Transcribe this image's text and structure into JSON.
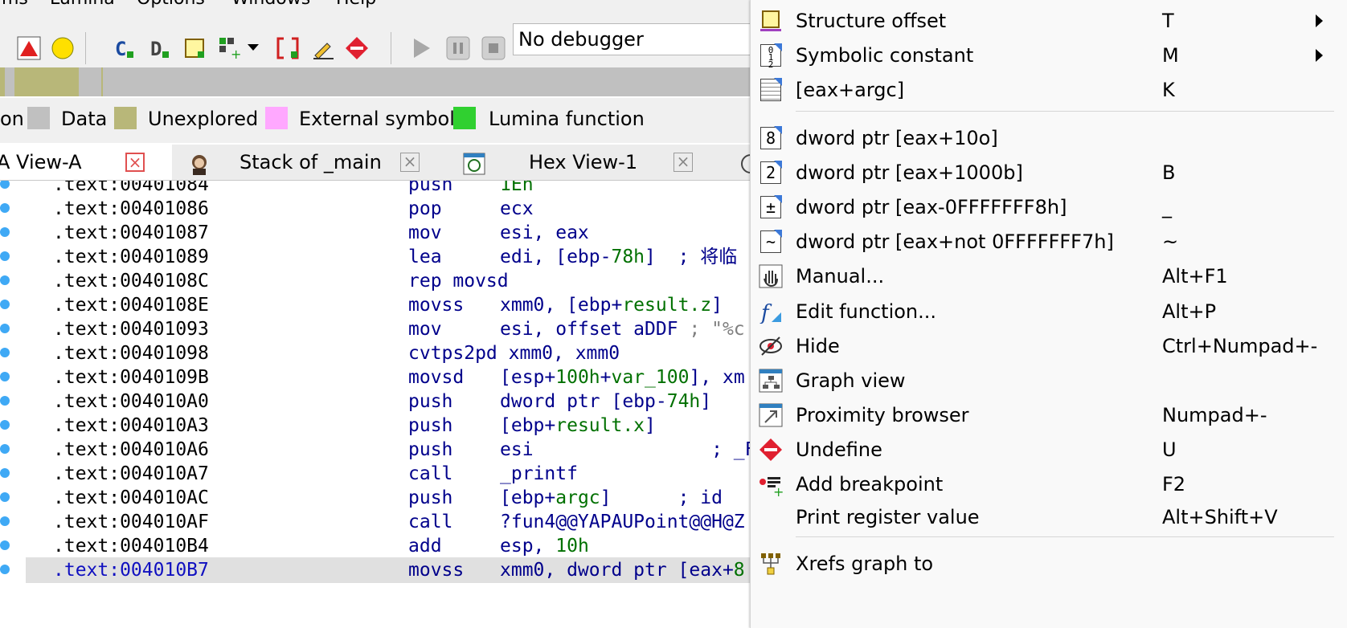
{
  "menubar": [
    "ms",
    "Lumina",
    "Options",
    "Windows",
    "Help"
  ],
  "toolbar": {
    "debugger_select": "No debugger",
    "icons": [
      "red-triangle-icon",
      "yellow-circle-icon",
      "code-icon",
      "data-icon",
      "struct-icon",
      "add-icon",
      "dropdown-icon",
      "bracket-icon",
      "edit-icon",
      "undefine-icon",
      "play-icon",
      "pause-icon",
      "stop-icon"
    ]
  },
  "legend": [
    {
      "label": "on",
      "color": null
    },
    {
      "label": "Data",
      "color": "#c0c0c0"
    },
    {
      "label": "Unexplored",
      "color": "#b8b779"
    },
    {
      "label": "External symbol",
      "color": "#ffa8ff"
    },
    {
      "label": "Lumina function",
      "color": "#30d030"
    }
  ],
  "tabs": [
    {
      "label": "A View-A"
    },
    {
      "label": "Stack of _main"
    },
    {
      "label": "Hex View-1"
    }
  ],
  "disasm": [
    {
      "addr": ".text:00401084",
      "mn": "push",
      "op": [
        [
          "1Eh",
          "g"
        ]
      ]
    },
    {
      "addr": ".text:00401086",
      "mn": "pop",
      "op": [
        [
          "ecx",
          "b"
        ]
      ]
    },
    {
      "addr": ".text:00401087",
      "mn": "mov",
      "op": [
        [
          "esi, eax",
          "b"
        ]
      ]
    },
    {
      "addr": ".text:00401089",
      "mn": "lea",
      "op": [
        [
          "edi, [ebp-",
          "b"
        ],
        [
          "78h",
          "g"
        ],
        [
          "]  ; 将临",
          "b"
        ]
      ]
    },
    {
      "addr": ".text:0040108C",
      "mn": "rep movsd",
      "op": []
    },
    {
      "addr": ".text:0040108E",
      "mn": "movss",
      "op": [
        [
          "xmm0, [ebp+",
          "b"
        ],
        [
          "result.z",
          "g"
        ],
        [
          "]",
          "b"
        ]
      ]
    },
    {
      "addr": ".text:00401093",
      "mn": "mov",
      "op": [
        [
          "esi, offset aDDF ",
          "b"
        ],
        [
          "; \"%c",
          "gray"
        ]
      ]
    },
    {
      "addr": ".text:00401098",
      "mn": "cvtps2pd xmm0, xmm0",
      "op": []
    },
    {
      "addr": ".text:0040109B",
      "mn": "movsd",
      "op": [
        [
          "[esp+",
          "b"
        ],
        [
          "100h",
          "g"
        ],
        [
          "+",
          "b"
        ],
        [
          "var_100",
          "g"
        ],
        [
          "], xm",
          "b"
        ]
      ]
    },
    {
      "addr": ".text:004010A0",
      "mn": "push",
      "op": [
        [
          "dword ptr [ebp-",
          "b"
        ],
        [
          "74h",
          "g"
        ],
        [
          "]",
          "b"
        ]
      ]
    },
    {
      "addr": ".text:004010A3",
      "mn": "push",
      "op": [
        [
          "[ebp+",
          "b"
        ],
        [
          "result.x",
          "g"
        ],
        [
          "]",
          "b"
        ]
      ]
    },
    {
      "addr": ".text:004010A6",
      "mn": "push",
      "op": [
        [
          "esi                ; _For",
          "b"
        ]
      ]
    },
    {
      "addr": ".text:004010A7",
      "mn": "call",
      "op": [
        [
          "_printf",
          "b"
        ]
      ]
    },
    {
      "addr": ".text:004010AC",
      "mn": "push",
      "op": [
        [
          "[ebp+",
          "b"
        ],
        [
          "argc",
          "g"
        ],
        [
          "]      ; id",
          "b"
        ]
      ]
    },
    {
      "addr": ".text:004010AF",
      "mn": "call",
      "op": [
        [
          "?fun4@@YAPAUPoint@@H@Z",
          "b"
        ]
      ]
    },
    {
      "addr": ".text:004010B4",
      "mn": "add",
      "op": [
        [
          "esp, ",
          "b"
        ],
        [
          "10h",
          "g"
        ]
      ]
    },
    {
      "addr": ".text:004010B7",
      "mn": "movss",
      "op": [
        [
          "xmm0, dword ptr [eax+",
          "b"
        ],
        [
          "8",
          "g"
        ]
      ],
      "highlight": true
    }
  ],
  "context_menu": [
    {
      "label": "Structure offset",
      "key": "T",
      "submenu": true,
      "icon": "structure-offset-icon"
    },
    {
      "label": "Symbolic constant",
      "key": "M",
      "submenu": true,
      "icon": "symbolic-constant-icon"
    },
    {
      "label": "[eax+argc]",
      "key": "K",
      "icon": "stack-var-icon"
    },
    {
      "label": "dword ptr [eax+10o]",
      "key": "",
      "icon": "octal-icon",
      "glyph": "8"
    },
    {
      "label": "dword ptr [eax+1000b]",
      "key": "B",
      "icon": "binary-icon",
      "glyph": "2"
    },
    {
      "label": "dword ptr [eax-0FFFFFFF8h]",
      "key": "_",
      "icon": "negate-icon",
      "glyph": "±"
    },
    {
      "label": "dword ptr [eax+not 0FFFFFFF7h]",
      "key": "~",
      "icon": "bitwise-not-icon",
      "glyph": "~"
    },
    {
      "label": "Manual...",
      "key": "Alt+F1",
      "icon": "hand-icon"
    },
    {
      "label": "Edit function...",
      "key": "Alt+P",
      "icon": "function-icon"
    },
    {
      "label": "Hide",
      "key": "Ctrl+Numpad+-",
      "icon": "eye-icon"
    },
    {
      "label": "Graph view",
      "key": "",
      "icon": "graph-icon"
    },
    {
      "label": "Proximity browser",
      "key": "Numpad+-",
      "icon": "proximity-icon"
    },
    {
      "label": "Undefine",
      "key": "U",
      "icon": "undefine-icon"
    },
    {
      "label": "Add breakpoint",
      "key": "F2",
      "icon": "breakpoint-icon"
    },
    {
      "label": "Print register value",
      "key": "Alt+Shift+V",
      "icon": ""
    },
    {
      "label": "Xrefs graph to",
      "key": "",
      "icon": "xrefs-graph-icon"
    }
  ]
}
